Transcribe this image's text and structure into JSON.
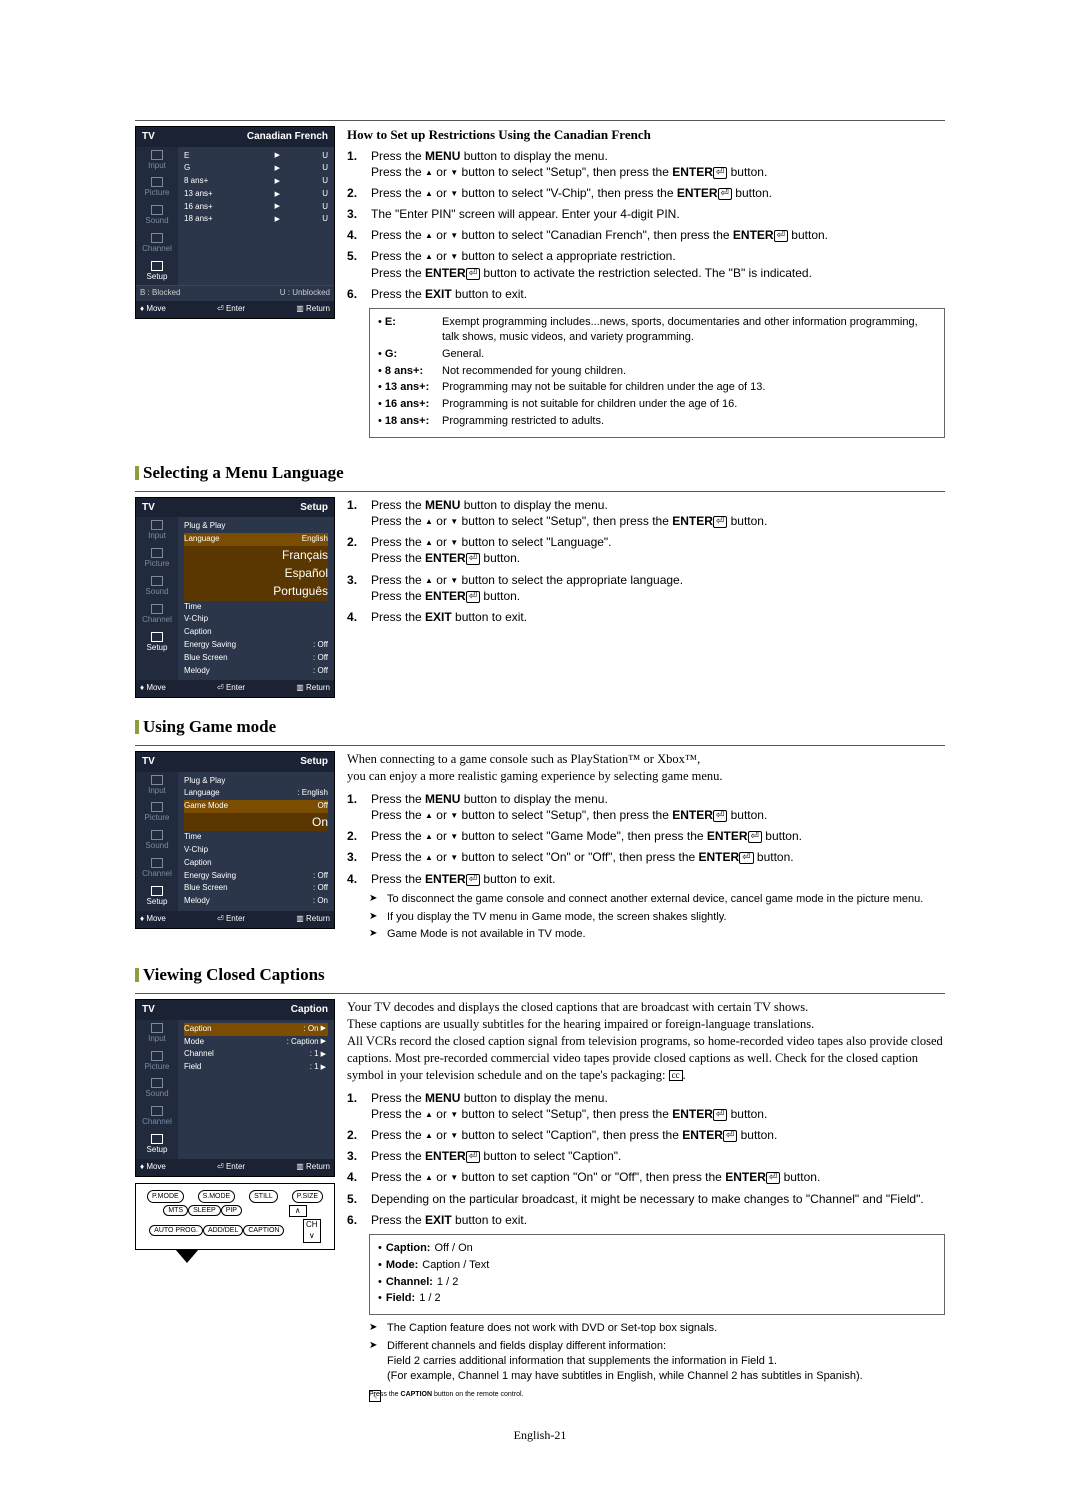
{
  "osd1": {
    "title_left": "TV",
    "title_right": "Canadian French",
    "side": [
      "Input",
      "Picture",
      "Sound",
      "Channel",
      "Setup"
    ],
    "rows": [
      {
        "k": "E",
        "v": "U",
        "a": "▶"
      },
      {
        "k": "G",
        "v": "U",
        "a": "▶"
      },
      {
        "k": "8 ans+",
        "v": "U",
        "a": "▶"
      },
      {
        "k": "13 ans+",
        "v": "U",
        "a": "▶"
      },
      {
        "k": "16 ans+",
        "v": "U",
        "a": "▶"
      },
      {
        "k": "18 ans+",
        "v": "U",
        "a": "▶"
      }
    ],
    "legend_l": "B : Blocked",
    "legend_r": "U : Unblocked",
    "foot_l": "Move",
    "foot_c": "Enter",
    "foot_r": "Return"
  },
  "sec1": {
    "head": "How to Set up Restrictions Using the Canadian French",
    "s1a": "Press the ",
    "s1b": "MENU",
    "s1c": " button to display the menu.",
    "s1d": "Press the ",
    "s1e": " or ",
    "s1f": " button to select \"Setup\", then press the ",
    "s1g": "ENTER",
    "s1h": " button.",
    "s2a": "Press the ",
    "s2b": " or ",
    "s2c": " button to select \"V-Chip\", then press the ",
    "s2d": "ENTER",
    "s2e": " button.",
    "s3": "The \"Enter PIN\" screen will appear. Enter your 4-digit PIN.",
    "s4a": "Press the ",
    "s4b": " or ",
    "s4c": " button to select \"Canadian French\", then press the ",
    "s4d": "ENTER",
    "s4e": " button.",
    "s5a": "Press the ",
    "s5b": " or ",
    "s5c": " button to select a appropriate restriction.",
    "s5d": "Press the ",
    "s5e": "ENTER",
    "s5f": " button to activate the restriction selected. The \"B\" is indicated.",
    "s6a": "Press the ",
    "s6b": "EXIT",
    "s6c": " button to exit.",
    "defs": [
      {
        "t": "E:",
        "d": "Exempt programming includes...news, sports, documentaries and other information programming, talk shows, music videos, and variety programming."
      },
      {
        "t": "G:",
        "d": "General."
      },
      {
        "t": "8 ans+:",
        "d": "Not recommended for young children."
      },
      {
        "t": "13 ans+:",
        "d": "Programming may not be suitable for children under the age of 13."
      },
      {
        "t": "16 ans+:",
        "d": "Programming is not suitable for children under the age of 16."
      },
      {
        "t": "18 ans+:",
        "d": "Programming restricted to adults."
      }
    ]
  },
  "osd2": {
    "title_left": "TV",
    "title_right": "Setup",
    "side": [
      "Input",
      "Picture",
      "Sound",
      "Channel",
      "Setup"
    ],
    "rows": [
      {
        "k": "Plug & Play",
        "v": ""
      },
      {
        "k": "Language",
        "v": "English",
        "sel": true
      },
      {
        "k": "",
        "v": "Français",
        "sub": true
      },
      {
        "k": "",
        "v": "Español",
        "sub": true
      },
      {
        "k": "",
        "v": "Português",
        "sub": true
      },
      {
        "k": "Time",
        "v": ""
      },
      {
        "k": "V-Chip",
        "v": ""
      },
      {
        "k": "Caption",
        "v": ""
      },
      {
        "k": "Energy Saving",
        "v": ": Off"
      },
      {
        "k": "Blue Screen",
        "v": ": Off"
      },
      {
        "k": "Melody",
        "v": ": Off"
      }
    ],
    "foot_l": "Move",
    "foot_c": "Enter",
    "foot_r": "Return"
  },
  "sec2": {
    "title": "Selecting a Menu Language",
    "s1a": "Press the ",
    "s1b": "MENU",
    "s1c": " button to display the menu.",
    "s1d": "Press the ",
    "s1e": " or ",
    "s1f": " button to select \"Setup\", then press the ",
    "s1g": "ENTER",
    "s1h": " button.",
    "s2a": "Press the ",
    "s2b": " or ",
    "s2c": " button to select \"Language\".",
    "s2d": "Press the ",
    "s2e": "ENTER",
    "s2f": " button.",
    "s3a": "Press the ",
    "s3b": " or ",
    "s3c": " button to select the appropriate language.",
    "s3d": "Press the ",
    "s3e": "ENTER",
    "s3f": " button.",
    "s4a": "Press the ",
    "s4b": "EXIT",
    "s4c": " button to exit."
  },
  "osd3": {
    "title_left": "TV",
    "title_right": "Setup",
    "side": [
      "Input",
      "Picture",
      "Sound",
      "Channel",
      "Setup"
    ],
    "rows": [
      {
        "k": "Plug & Play",
        "v": ""
      },
      {
        "k": "Language",
        "v": ": English"
      },
      {
        "k": "Game Mode",
        "v": "Off",
        "sel": true
      },
      {
        "k": "",
        "v": "On",
        "sub": true
      },
      {
        "k": "Time",
        "v": ""
      },
      {
        "k": "V-Chip",
        "v": ""
      },
      {
        "k": "Caption",
        "v": ""
      },
      {
        "k": "Energy Saving",
        "v": ": Off"
      },
      {
        "k": "Blue Screen",
        "v": ": Off"
      },
      {
        "k": "Melody",
        "v": ": On"
      }
    ],
    "foot_l": "Move",
    "foot_c": "Enter",
    "foot_r": "Return"
  },
  "sec3": {
    "title": "Using Game mode",
    "intro1": "When connecting to a game console such as PlayStation™ or Xbox™,",
    "intro2": "you can enjoy a more realistic gaming experience by selecting game menu.",
    "s1a": "Press the ",
    "s1b": "MENU",
    "s1c": " button to display the menu.",
    "s1d": "Press the ",
    "s1e": " or ",
    "s1f": " button to select \"Setup\", then press the ",
    "s1g": "ENTER",
    "s1h": " button.",
    "s2a": "Press the ",
    "s2b": " or ",
    "s2c": " button to select \"Game Mode\", then press the ",
    "s2d": "ENTER",
    "s2e": " button.",
    "s3a": "Press the ",
    "s3b": " or ",
    "s3c": " button to select \"On\" or \"Off\", then press the ",
    "s3d": "ENTER",
    "s3e": " button.",
    "s4a": "Press the ",
    "s4b": "ENTER",
    "s4c": " button to exit.",
    "n1": "To disconnect the game console and connect another external device, cancel game  mode in the picture menu.",
    "n2": "If you display the TV menu in Game mode, the screen shakes slightly.",
    "n3": "Game Mode is not available in TV mode."
  },
  "osd4": {
    "title_left": "TV",
    "title_right": "Caption",
    "side": [
      "Input",
      "Picture",
      "Sound",
      "Channel",
      "Setup"
    ],
    "rows": [
      {
        "k": "Caption",
        "v": ": On",
        "sel": true,
        "ar": true
      },
      {
        "k": "Mode",
        "v": ": Caption",
        "ar": true
      },
      {
        "k": "Channel",
        "v": ": 1",
        "ar": true
      },
      {
        "k": "Field",
        "v": ": 1",
        "ar": true
      }
    ],
    "foot_l": "Move",
    "foot_c": "Enter",
    "foot_r": "Return"
  },
  "remote": {
    "r1": [
      "P.MODE",
      "S.MODE",
      "STILL",
      "P.SIZE"
    ],
    "r2": [
      "MTS",
      "SLEEP",
      "PIP"
    ],
    "r3": [
      "AUTO PROG.",
      "ADD/DEL",
      "CAPTION"
    ],
    "ch": "CH"
  },
  "sec4": {
    "title": "Viewing Closed Captions",
    "p1": "Your TV decodes and displays the closed captions that are broadcast with certain TV shows.",
    "p2": "These captions are usually subtitles for the hearing impaired or foreign-language translations.",
    "p3": "All VCRs record the closed caption signal from television programs, so home-recorded video tapes also provide closed captions. Most pre-recorded commercial video tapes provide closed captions as well. Check for the closed caption symbol in your television schedule and on the tape's packaging: ",
    "cc": "cc",
    "p3b": ".",
    "s1a": "Press the ",
    "s1b": "MENU",
    "s1c": " button to display the menu.",
    "s1d": "Press the ",
    "s1e": " or ",
    "s1f": " button to select \"Setup\", then press the ",
    "s1g": "ENTER",
    "s1h": " button.",
    "s2a": "Press the ",
    "s2b": " or ",
    "s2c": " button to select \"Caption\", then press the ",
    "s2d": "ENTER",
    "s2e": " button.",
    "s3a": "Press the ",
    "s3b": "ENTER",
    "s3c": " button to select \"Caption\".",
    "s4a": "Press the ",
    "s4b": " or ",
    "s4c": " button to set caption \"On\" or \"Off\", then press the ",
    "s4d": "ENTER",
    "s4e": " button.",
    "s5": "Depending on the particular broadcast, it might be necessary to make changes to \"Channel\" and \"Field\".",
    "s6a": "Press the ",
    "s6b": "EXIT",
    "s6c": " button to exit.",
    "opts": [
      {
        "b": "Caption:",
        "t": " Off / On"
      },
      {
        "b": "Mode:",
        "t": " Caption / Text"
      },
      {
        "b": "Channel:",
        "t": " 1 / 2"
      },
      {
        "b": "Field:",
        "t": " 1 / 2"
      }
    ],
    "n1": "The Caption feature does not work with DVD or Set-top box signals.",
    "n2": "Different channels and fields display different information:",
    "n2b": "Field 2 carries additional information that supplements the information in Field 1.",
    "n2c": "(For example, Channel 1 may have subtitles in English, while Channel 2 has subtitles in Spanish).",
    "n3a": "Press the ",
    "n3b": "CAPTION",
    "n3c": " button on the remote control."
  },
  "pagefoot": "English-21"
}
